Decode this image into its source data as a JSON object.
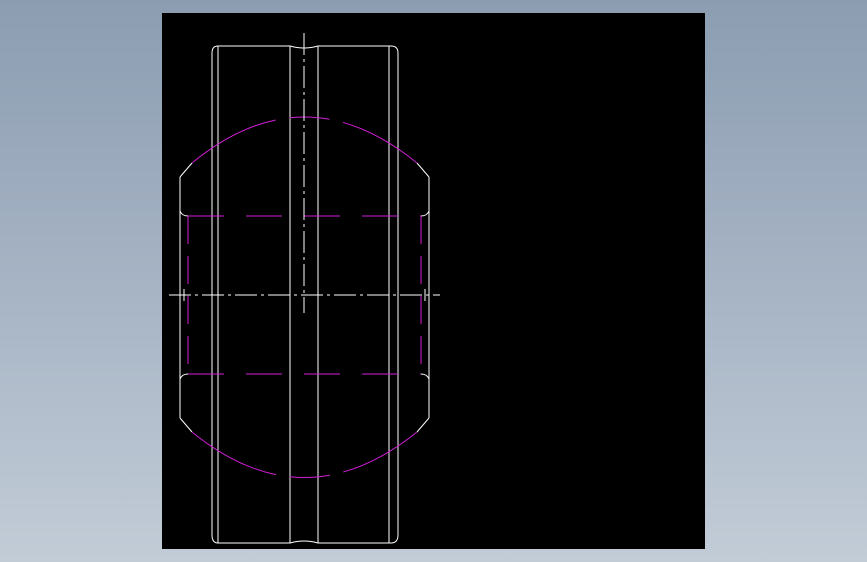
{
  "drawing": {
    "background_color": "#000000",
    "outline_color": "#ffffff",
    "hidden_line_color": "#d11fd6",
    "centerline_color": "#ffffff"
  }
}
